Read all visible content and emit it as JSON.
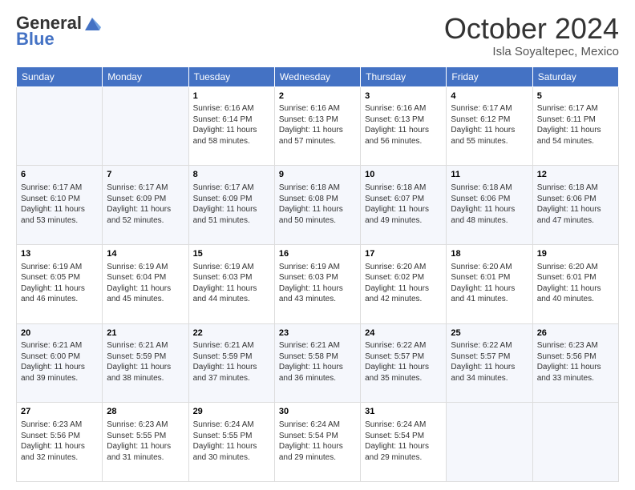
{
  "header": {
    "logo_line1": "General",
    "logo_line2": "Blue",
    "month": "October 2024",
    "location": "Isla Soyaltepec, Mexico"
  },
  "days_of_week": [
    "Sunday",
    "Monday",
    "Tuesday",
    "Wednesday",
    "Thursday",
    "Friday",
    "Saturday"
  ],
  "weeks": [
    [
      {
        "day": "",
        "info": ""
      },
      {
        "day": "",
        "info": ""
      },
      {
        "day": "1",
        "info": "Sunrise: 6:16 AM\nSunset: 6:14 PM\nDaylight: 11 hours and 58 minutes."
      },
      {
        "day": "2",
        "info": "Sunrise: 6:16 AM\nSunset: 6:13 PM\nDaylight: 11 hours and 57 minutes."
      },
      {
        "day": "3",
        "info": "Sunrise: 6:16 AM\nSunset: 6:13 PM\nDaylight: 11 hours and 56 minutes."
      },
      {
        "day": "4",
        "info": "Sunrise: 6:17 AM\nSunset: 6:12 PM\nDaylight: 11 hours and 55 minutes."
      },
      {
        "day": "5",
        "info": "Sunrise: 6:17 AM\nSunset: 6:11 PM\nDaylight: 11 hours and 54 minutes."
      }
    ],
    [
      {
        "day": "6",
        "info": "Sunrise: 6:17 AM\nSunset: 6:10 PM\nDaylight: 11 hours and 53 minutes."
      },
      {
        "day": "7",
        "info": "Sunrise: 6:17 AM\nSunset: 6:09 PM\nDaylight: 11 hours and 52 minutes."
      },
      {
        "day": "8",
        "info": "Sunrise: 6:17 AM\nSunset: 6:09 PM\nDaylight: 11 hours and 51 minutes."
      },
      {
        "day": "9",
        "info": "Sunrise: 6:18 AM\nSunset: 6:08 PM\nDaylight: 11 hours and 50 minutes."
      },
      {
        "day": "10",
        "info": "Sunrise: 6:18 AM\nSunset: 6:07 PM\nDaylight: 11 hours and 49 minutes."
      },
      {
        "day": "11",
        "info": "Sunrise: 6:18 AM\nSunset: 6:06 PM\nDaylight: 11 hours and 48 minutes."
      },
      {
        "day": "12",
        "info": "Sunrise: 6:18 AM\nSunset: 6:06 PM\nDaylight: 11 hours and 47 minutes."
      }
    ],
    [
      {
        "day": "13",
        "info": "Sunrise: 6:19 AM\nSunset: 6:05 PM\nDaylight: 11 hours and 46 minutes."
      },
      {
        "day": "14",
        "info": "Sunrise: 6:19 AM\nSunset: 6:04 PM\nDaylight: 11 hours and 45 minutes."
      },
      {
        "day": "15",
        "info": "Sunrise: 6:19 AM\nSunset: 6:03 PM\nDaylight: 11 hours and 44 minutes."
      },
      {
        "day": "16",
        "info": "Sunrise: 6:19 AM\nSunset: 6:03 PM\nDaylight: 11 hours and 43 minutes."
      },
      {
        "day": "17",
        "info": "Sunrise: 6:20 AM\nSunset: 6:02 PM\nDaylight: 11 hours and 42 minutes."
      },
      {
        "day": "18",
        "info": "Sunrise: 6:20 AM\nSunset: 6:01 PM\nDaylight: 11 hours and 41 minutes."
      },
      {
        "day": "19",
        "info": "Sunrise: 6:20 AM\nSunset: 6:01 PM\nDaylight: 11 hours and 40 minutes."
      }
    ],
    [
      {
        "day": "20",
        "info": "Sunrise: 6:21 AM\nSunset: 6:00 PM\nDaylight: 11 hours and 39 minutes."
      },
      {
        "day": "21",
        "info": "Sunrise: 6:21 AM\nSunset: 5:59 PM\nDaylight: 11 hours and 38 minutes."
      },
      {
        "day": "22",
        "info": "Sunrise: 6:21 AM\nSunset: 5:59 PM\nDaylight: 11 hours and 37 minutes."
      },
      {
        "day": "23",
        "info": "Sunrise: 6:21 AM\nSunset: 5:58 PM\nDaylight: 11 hours and 36 minutes."
      },
      {
        "day": "24",
        "info": "Sunrise: 6:22 AM\nSunset: 5:57 PM\nDaylight: 11 hours and 35 minutes."
      },
      {
        "day": "25",
        "info": "Sunrise: 6:22 AM\nSunset: 5:57 PM\nDaylight: 11 hours and 34 minutes."
      },
      {
        "day": "26",
        "info": "Sunrise: 6:23 AM\nSunset: 5:56 PM\nDaylight: 11 hours and 33 minutes."
      }
    ],
    [
      {
        "day": "27",
        "info": "Sunrise: 6:23 AM\nSunset: 5:56 PM\nDaylight: 11 hours and 32 minutes."
      },
      {
        "day": "28",
        "info": "Sunrise: 6:23 AM\nSunset: 5:55 PM\nDaylight: 11 hours and 31 minutes."
      },
      {
        "day": "29",
        "info": "Sunrise: 6:24 AM\nSunset: 5:55 PM\nDaylight: 11 hours and 30 minutes."
      },
      {
        "day": "30",
        "info": "Sunrise: 6:24 AM\nSunset: 5:54 PM\nDaylight: 11 hours and 29 minutes."
      },
      {
        "day": "31",
        "info": "Sunrise: 6:24 AM\nSunset: 5:54 PM\nDaylight: 11 hours and 29 minutes."
      },
      {
        "day": "",
        "info": ""
      },
      {
        "day": "",
        "info": ""
      }
    ]
  ]
}
